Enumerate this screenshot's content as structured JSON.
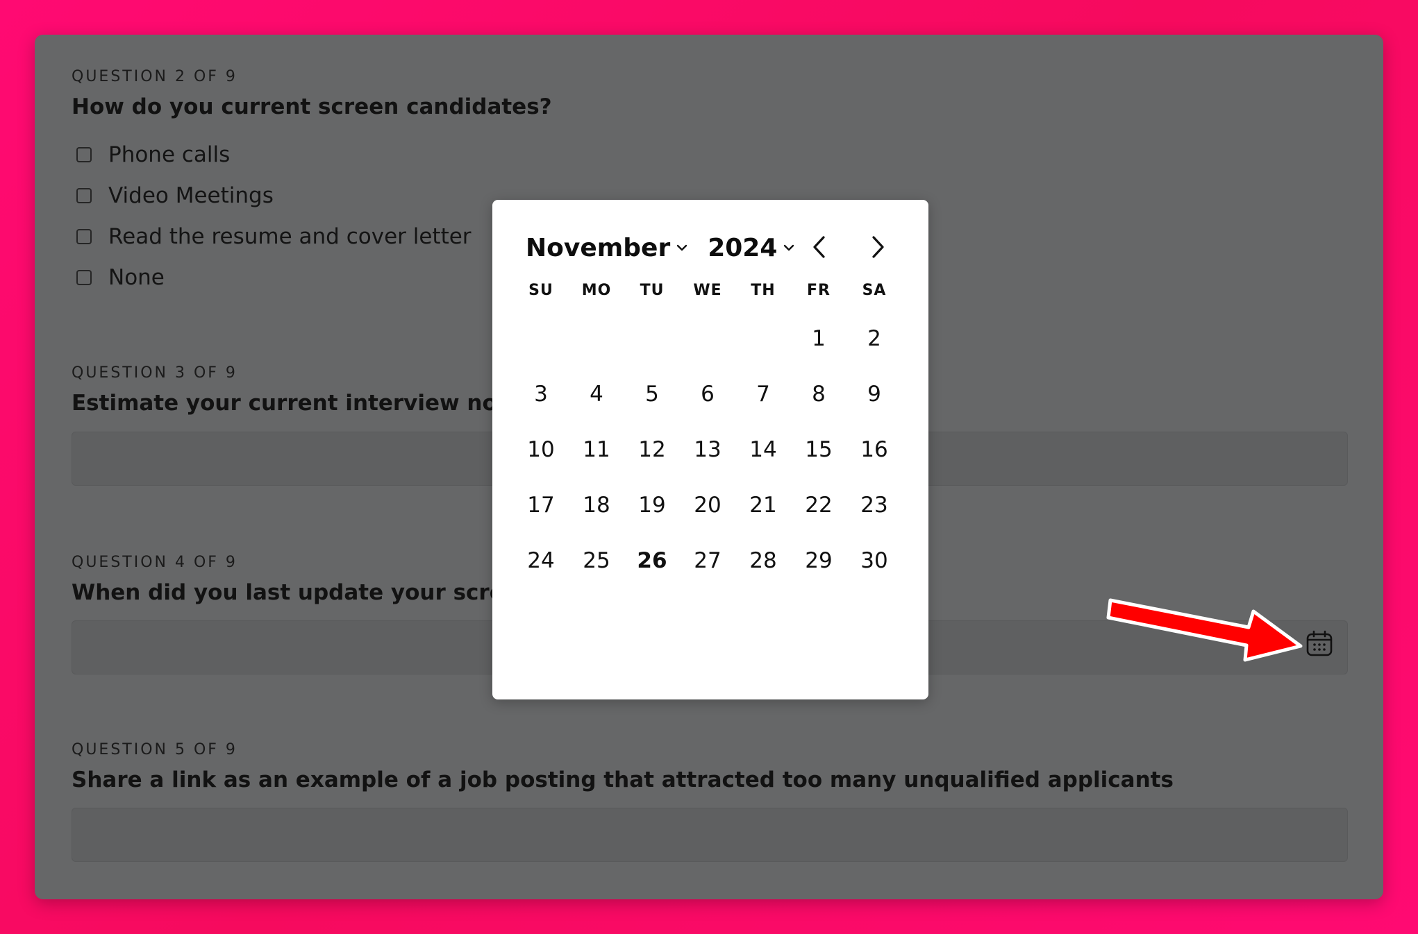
{
  "questions": [
    {
      "label": "QUESTION 2 OF 9",
      "title": "How do you current screen candidates?",
      "options": [
        "Phone calls",
        "Video Meetings",
        "Read the resume and cover letter",
        "None"
      ]
    },
    {
      "label": "QUESTION 3 OF 9",
      "title": "Estimate your current interview no-show rate"
    },
    {
      "label": "QUESTION 4 OF 9",
      "title": "When did you last update your screening process?"
    },
    {
      "label": "QUESTION 5 OF 9",
      "title": "Share a link as an example of a job posting that attracted too many unqualified applicants"
    }
  ],
  "datepicker": {
    "month": "November",
    "year": "2024",
    "weekdays": [
      "SU",
      "MO",
      "TU",
      "WE",
      "TH",
      "FR",
      "SA"
    ],
    "weeks": [
      [
        "",
        "",
        "",
        "",
        "",
        "1",
        "2"
      ],
      [
        "3",
        "4",
        "5",
        "6",
        "7",
        "8",
        "9"
      ],
      [
        "10",
        "11",
        "12",
        "13",
        "14",
        "15",
        "16"
      ],
      [
        "17",
        "18",
        "19",
        "20",
        "21",
        "22",
        "23"
      ],
      [
        "24",
        "25",
        "26",
        "27",
        "28",
        "29",
        "30"
      ]
    ],
    "today": "26"
  },
  "icons": {
    "calendar": "calendar-icon",
    "prev": "chevron-left-icon",
    "next": "chevron-right-icon",
    "dropdown": "chevron-down-icon"
  },
  "colors": {
    "background": "#ff0a72",
    "card": "#666768",
    "annotation_arrow": "#ff0000"
  }
}
